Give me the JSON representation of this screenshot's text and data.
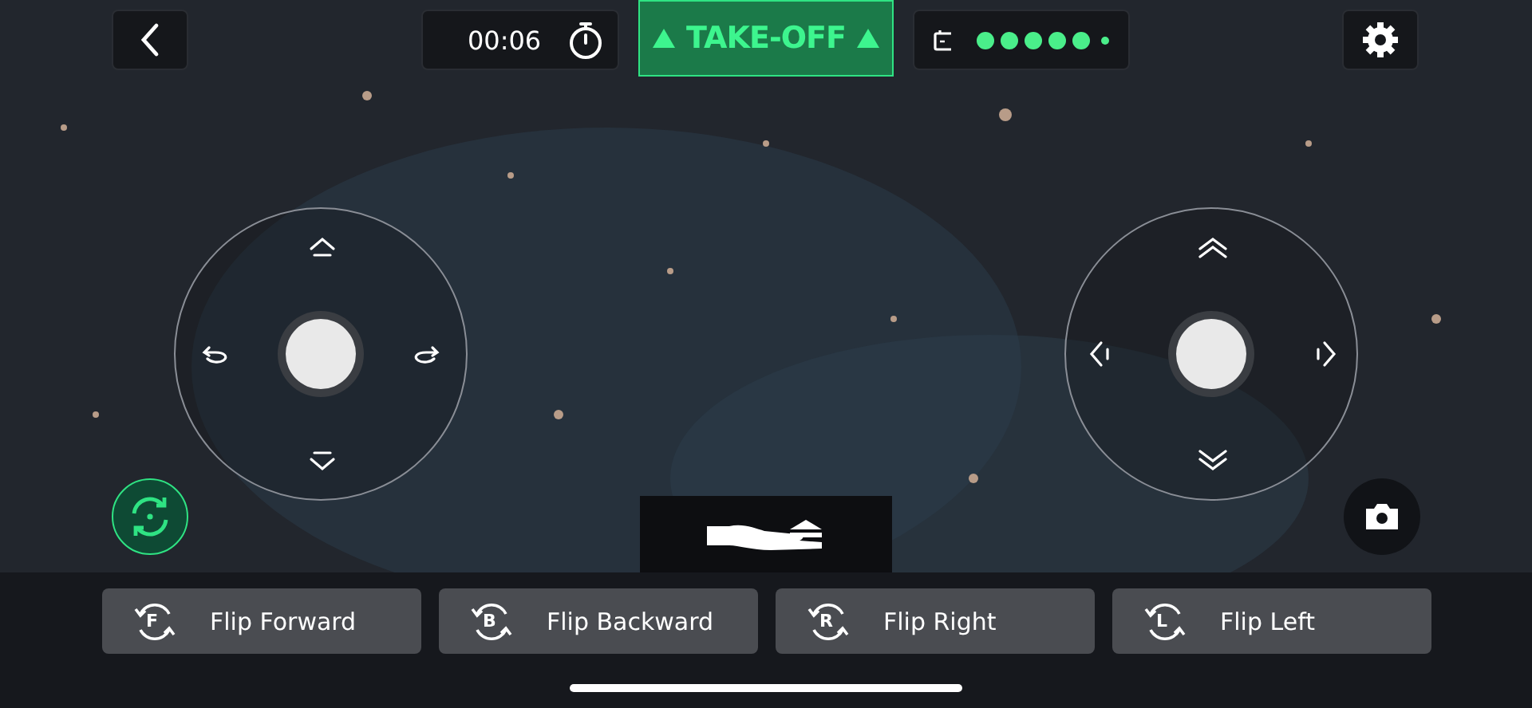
{
  "timer": {
    "time": "00:06"
  },
  "takeoff": {
    "label": "TAKE-OFF"
  },
  "joysticks": [
    {
      "kind": "yaw"
    },
    {
      "kind": "move"
    }
  ],
  "flips": [
    {
      "label": "Flip Forward",
      "letter": "F"
    },
    {
      "label": "Flip Backward",
      "letter": "B"
    },
    {
      "label": "Flip Right",
      "letter": "R"
    },
    {
      "label": "Flip Left",
      "letter": "L"
    }
  ]
}
